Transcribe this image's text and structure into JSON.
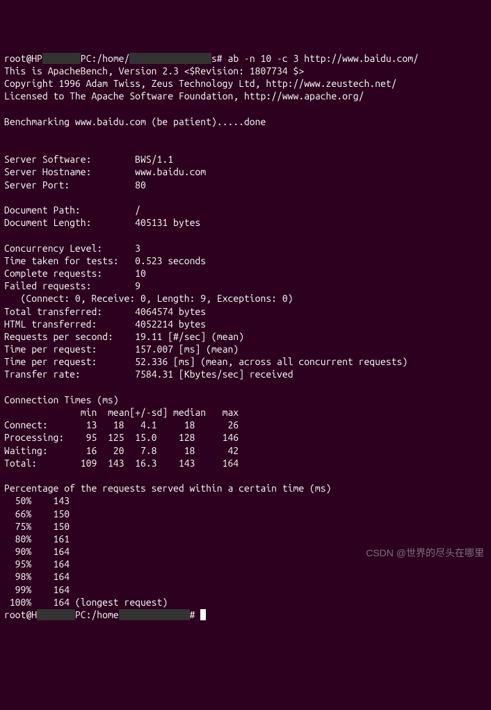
{
  "prompt1": {
    "user": "root@HP",
    "host_redacted": "       ",
    "path": "PC:/home/",
    "path_redacted": "               ",
    "suffix": "s# ",
    "command": "ab -n 10 -c 3 http://www.baidu.com/"
  },
  "header": {
    "line1": "This is ApacheBench, Version 2.3 <$Revision: 1807734 $>",
    "line2": "Copyright 1996 Adam Twiss, Zeus Technology Ltd, http://www.zeustech.net/",
    "line3": "Licensed to The Apache Software Foundation, http://www.apache.org/"
  },
  "benchmarking": "Benchmarking www.baidu.com (be patient).....done",
  "server": {
    "software_label": "Server Software:        ",
    "software_value": "BWS/1.1",
    "hostname_label": "Server Hostname:        ",
    "hostname_value": "www.baidu.com",
    "port_label": "Server Port:            ",
    "port_value": "80"
  },
  "document": {
    "path_label": "Document Path:          ",
    "path_value": "/",
    "length_label": "Document Length:        ",
    "length_value": "405131 bytes"
  },
  "results": {
    "concurrency_label": "Concurrency Level:      ",
    "concurrency_value": "3",
    "time_taken_label": "Time taken for tests:   ",
    "time_taken_value": "0.523 seconds",
    "complete_label": "Complete requests:      ",
    "complete_value": "10",
    "failed_label": "Failed requests:        ",
    "failed_value": "9",
    "failed_detail": "   (Connect: 0, Receive: 0, Length: 9, Exceptions: 0)",
    "total_transferred_label": "Total transferred:      ",
    "total_transferred_value": "4064574 bytes",
    "html_transferred_label": "HTML transferred:       ",
    "html_transferred_value": "4052214 bytes",
    "rps_label": "Requests per second:    ",
    "rps_value": "19.11 [#/sec] (mean)",
    "tpr1_label": "Time per request:       ",
    "tpr1_value": "157.007 [ms] (mean)",
    "tpr2_label": "Time per request:       ",
    "tpr2_value": "52.336 [ms] (mean, across all concurrent requests)",
    "transfer_label": "Transfer rate:          ",
    "transfer_value": "7584.31 [Kbytes/sec] received"
  },
  "conn_times": {
    "title": "Connection Times (ms)",
    "header": "              min  mean[+/-sd] median   max",
    "connect": "Connect:       13   18   4.1     18      26",
    "processing": "Processing:    95  125  15.0    128     146",
    "waiting": "Waiting:       16   20   7.8     18      42",
    "total": "Total:        109  143  16.3    143     164"
  },
  "percentiles": {
    "title": "Percentage of the requests served within a certain time (ms)",
    "p50": "  50%    143",
    "p66": "  66%    150",
    "p75": "  75%    150",
    "p80": "  80%    161",
    "p90": "  90%    164",
    "p95": "  95%    164",
    "p98": "  98%    164",
    "p99": "  99%    164",
    "p100": " 100%    164 (longest request)"
  },
  "prompt2": {
    "user": "root@H",
    "redacted1": "       ",
    "mid": "PC:/home",
    "redacted2": "             ",
    "suffix": "# "
  },
  "watermark": "CSDN @世界的尽头在哪里"
}
